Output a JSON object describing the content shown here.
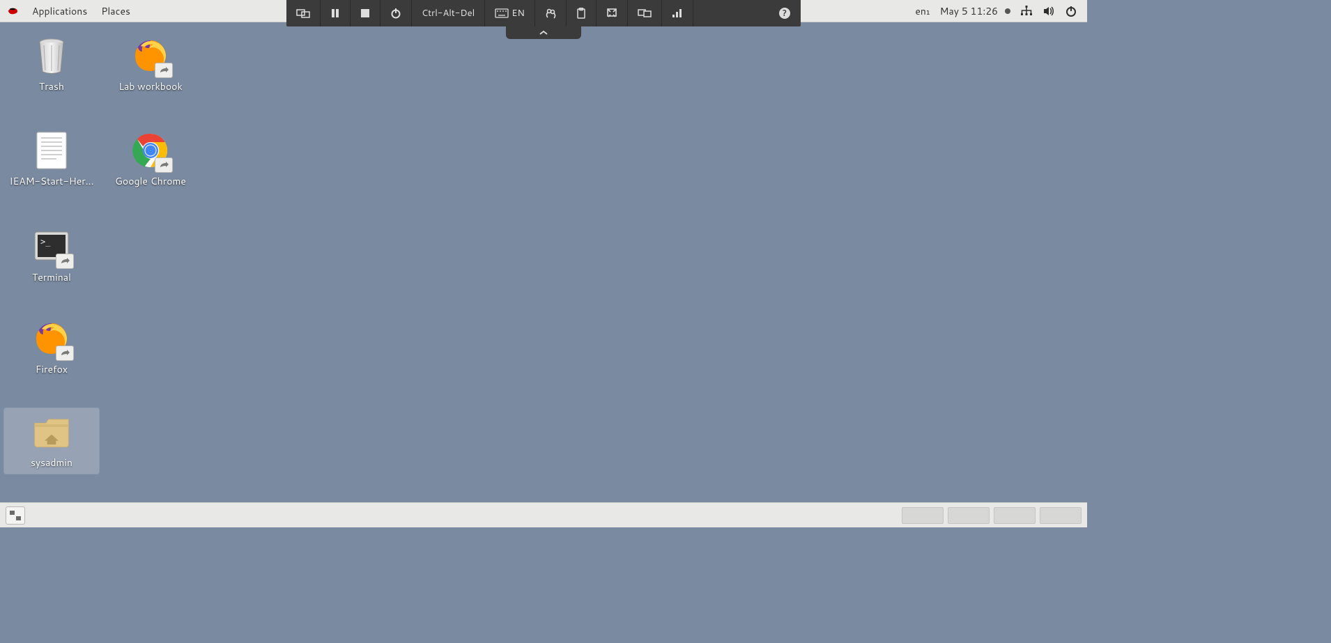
{
  "top_panel": {
    "menu": {
      "applications": "Applications",
      "places": "Places"
    },
    "status": {
      "keyboard_layout": "en₁",
      "date_time": "May 5  11:26"
    }
  },
  "rv_toolbar": {
    "ctrl_alt_del": "Ctrl-Alt-Del",
    "kb_lang": "EN"
  },
  "desktop_icons": {
    "trash": {
      "label": "Trash"
    },
    "lab_workbook": {
      "label": "Lab workbook"
    },
    "ieam": {
      "label": "IEAM-Start-Her..."
    },
    "chrome": {
      "label": "Google Chrome"
    },
    "terminal": {
      "label": "Terminal"
    },
    "firefox": {
      "label": "Firefox"
    },
    "sysadmin": {
      "label": "sysadmin"
    }
  }
}
